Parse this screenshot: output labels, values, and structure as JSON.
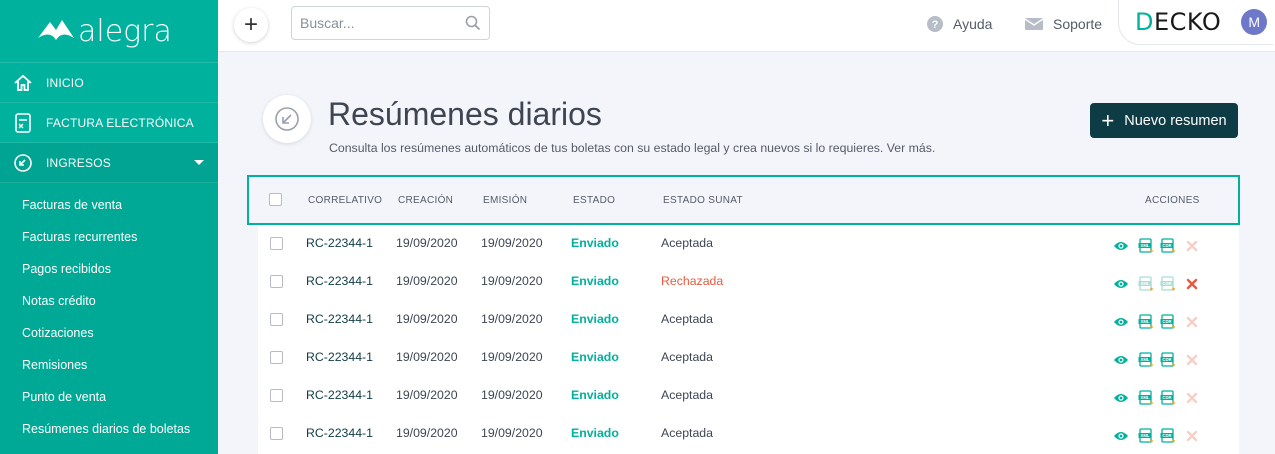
{
  "brand": {
    "name": "alegra"
  },
  "sidebar": {
    "main_items": [
      {
        "label": "INICIO",
        "icon": "home-icon"
      },
      {
        "label": "FACTURA ELECTRÓNICA",
        "icon": "invoice-icon"
      },
      {
        "label": "INGRESOS",
        "icon": "income-icon"
      }
    ],
    "sub_items": [
      "Facturas de venta",
      "Facturas recurrentes",
      "Pagos recibidos",
      "Notas crédito",
      "Cotizaciones",
      "Remisiones",
      "Punto de venta",
      "Resúmenes diarios de boletas"
    ]
  },
  "topbar": {
    "add_label": "+",
    "search_placeholder": "Buscar...",
    "help_label": "Ayuda",
    "support_label": "Soporte",
    "company": {
      "prefix": "D",
      "rest": "ECKO"
    },
    "avatar_initial": "M"
  },
  "page": {
    "title": "Resúmenes diarios",
    "description": "Consulta los resúmenes automáticos de tus boletas con su estado legal y crea nuevos si lo requieres. Ver más.",
    "new_button": "Nuevo resumen"
  },
  "table": {
    "columns": [
      "CORRELATIVO",
      "CREACIÓN",
      "EMISIÓN",
      "ESTADO",
      "ESTADO SUNAT",
      "ACCIONES"
    ],
    "rows": [
      {
        "correlativo": "RC-22344-1",
        "creacion": "19/09/2020",
        "emision": "19/09/2020",
        "estado": "Enviado",
        "sunat": "Aceptada"
      },
      {
        "correlativo": "RC-22344-1",
        "creacion": "19/09/2020",
        "emision": "19/09/2020",
        "estado": "Enviado",
        "sunat": "Rechazada"
      },
      {
        "correlativo": "RC-22344-1",
        "creacion": "19/09/2020",
        "emision": "19/09/2020",
        "estado": "Enviado",
        "sunat": "Aceptada"
      },
      {
        "correlativo": "RC-22344-1",
        "creacion": "19/09/2020",
        "emision": "19/09/2020",
        "estado": "Enviado",
        "sunat": "Aceptada"
      },
      {
        "correlativo": "RC-22344-1",
        "creacion": "19/09/2020",
        "emision": "19/09/2020",
        "estado": "Enviado",
        "sunat": "Aceptada"
      },
      {
        "correlativo": "RC-22344-1",
        "creacion": "19/09/2020",
        "emision": "19/09/2020",
        "estado": "Enviado",
        "sunat": "Aceptada"
      }
    ],
    "action_icons": [
      "eye-icon",
      "xml-icon",
      "cdr-icon",
      "close-icon"
    ]
  },
  "colors": {
    "primary": "#00b19d",
    "dark": "#0e3c45",
    "danger": "#e8593f"
  }
}
